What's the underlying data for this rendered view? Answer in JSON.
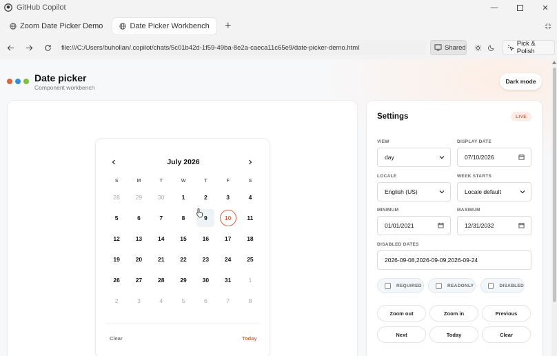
{
  "window": {
    "title": "GitHub Copilot"
  },
  "tabs": [
    {
      "label": "Zoom Date Picker Demo"
    },
    {
      "label": "Date Picker Workbench"
    }
  ],
  "address": {
    "url": "file:///C:/Users/buhollan/.copilot/chats/5c01b42d-1f59-49ba-8e2a-caeca11c65e9/date-picker-demo.html",
    "shared_label": "Shared",
    "pick_label": "Pick & Polish"
  },
  "page": {
    "title": "Date picker",
    "subtitle": "Component workbench",
    "dark_mode_label": "Dark mode",
    "dot_colors": [
      "#d9653b",
      "#2f8fd8",
      "#7cbf3a"
    ]
  },
  "calendar": {
    "month_label": "July 2026",
    "weekdays": [
      "S",
      "M",
      "T",
      "W",
      "T",
      "F",
      "S"
    ],
    "days": [
      [
        "28",
        "29",
        "30",
        "1",
        "2",
        "3",
        "4"
      ],
      [
        "5",
        "6",
        "7",
        "8",
        "9",
        "10",
        "11"
      ],
      [
        "12",
        "13",
        "14",
        "15",
        "16",
        "17",
        "18"
      ],
      [
        "19",
        "20",
        "21",
        "22",
        "23",
        "24",
        "25"
      ],
      [
        "26",
        "27",
        "28",
        "29",
        "30",
        "31",
        "1"
      ],
      [
        "2",
        "3",
        "4",
        "5",
        "6",
        "7",
        "8"
      ]
    ],
    "outside": [
      [
        0,
        0
      ],
      [
        0,
        1
      ],
      [
        0,
        2
      ],
      [
        4,
        6
      ],
      [
        5,
        0
      ],
      [
        5,
        1
      ],
      [
        5,
        2
      ],
      [
        5,
        3
      ],
      [
        5,
        4
      ],
      [
        5,
        5
      ],
      [
        5,
        6
      ]
    ],
    "hover": [
      1,
      4
    ],
    "selected": [
      1,
      5
    ],
    "clear_label": "Clear",
    "today_label": "Today",
    "accent": "#d9653b"
  },
  "settings": {
    "title": "Settings",
    "live_badge": "LIVE",
    "view_label": "VIEW",
    "view_value": "day",
    "display_date_label": "DISPLAY DATE",
    "display_date_value": "07/10/2026",
    "locale_label": "LOCALE",
    "locale_value": "English (US)",
    "week_starts_label": "WEEK STARTS",
    "week_starts_value": "Locale default",
    "minimum_label": "MINIMUM",
    "minimum_value": "01/01/2021",
    "maximum_label": "MAXIMUM",
    "maximum_value": "12/31/2032",
    "disabled_dates_label": "DISABLED DATES",
    "disabled_dates_value": "2026-09-08,2026-09-09,2026-09-24",
    "required_label": "REQUIRED",
    "readonly_label": "READONLY",
    "disabled_label": "DISABLED",
    "buttons": {
      "zoom_out": "Zoom out",
      "zoom_in": "Zoom in",
      "previous": "Previous",
      "next": "Next",
      "today": "Today",
      "clear": "Clear"
    }
  }
}
